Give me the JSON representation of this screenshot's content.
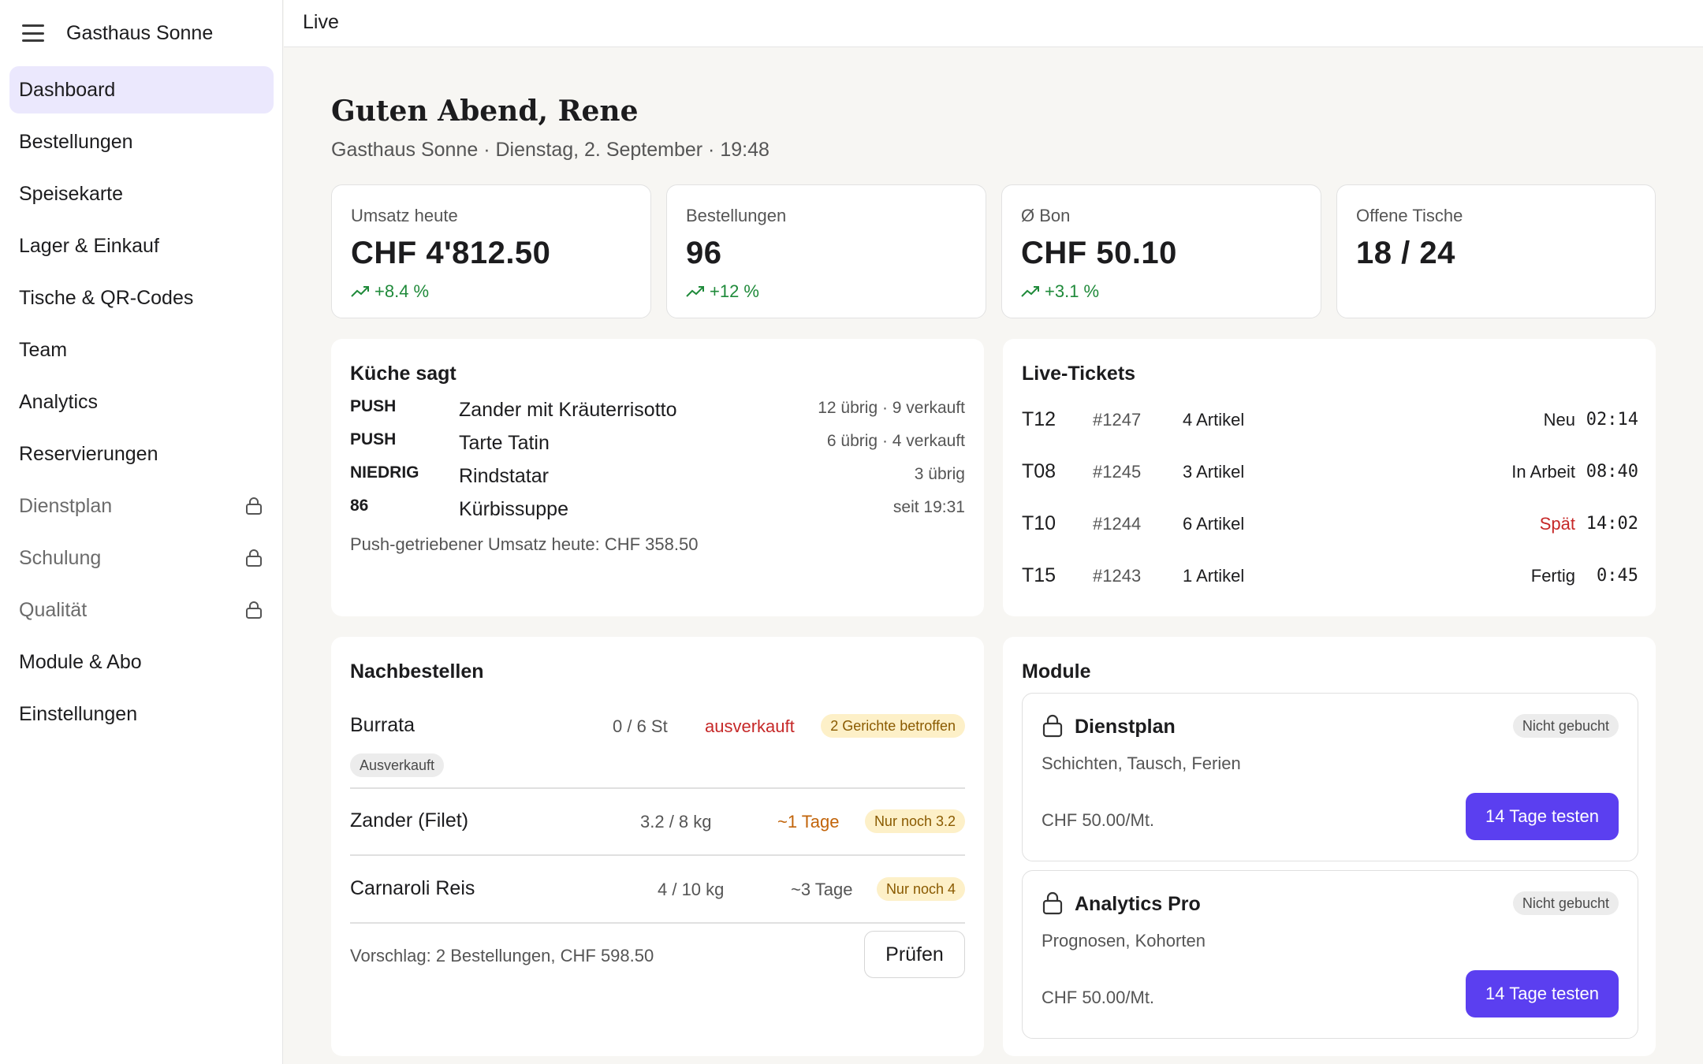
{
  "app": {
    "brand": "Gasthaus Sonne",
    "menu_icon": "hamburger-menu-icon",
    "page_title": "Live"
  },
  "sidebar": {
    "items": [
      {
        "label": "Dashboard",
        "active": true,
        "locked": false
      },
      {
        "label": "Bestellungen",
        "active": false,
        "locked": false
      },
      {
        "label": "Speisekarte",
        "active": false,
        "locked": false
      },
      {
        "label": "Lager & Einkauf",
        "active": false,
        "locked": false
      },
      {
        "label": "Tische & QR-Codes",
        "active": false,
        "locked": false
      },
      {
        "label": "Team",
        "active": false,
        "locked": false
      },
      {
        "label": "Analytics",
        "active": false,
        "locked": false
      },
      {
        "label": "Reservierungen",
        "active": false,
        "locked": false
      },
      {
        "label": "Dienstplan",
        "active": false,
        "locked": true
      },
      {
        "label": "Schulung",
        "active": false,
        "locked": true
      },
      {
        "label": "Qualität",
        "active": false,
        "locked": true
      },
      {
        "label": "Module & Abo",
        "active": false,
        "locked": false
      },
      {
        "label": "Einstellungen",
        "active": false,
        "locked": false
      }
    ]
  },
  "header": {
    "greeting": "Guten Abend, Rene",
    "subtitle": "Gasthaus Sonne · Dienstag, 2. September · 19:48"
  },
  "kpis": [
    {
      "label": "Umsatz heute",
      "value": "CHF 4'812.50",
      "delta": "+8.4 %"
    },
    {
      "label": "Bestellungen",
      "value": "96",
      "delta": "+12 %"
    },
    {
      "label": "Ø Bon",
      "value": "CHF 50.10",
      "delta": "+3.1 %"
    },
    {
      "label": "Offene Tische",
      "value": "18 / 24",
      "delta": ""
    }
  ],
  "kitchen": {
    "title": "Küche sagt",
    "rows": [
      {
        "tag": "PUSH",
        "dish": "Zander mit Kräuterrisotto",
        "info": "12 übrig · 9 verkauft"
      },
      {
        "tag": "PUSH",
        "dish": "Tarte Tatin",
        "info": "6 übrig · 4 verkauft"
      },
      {
        "tag": "NIEDRIG",
        "dish": "Rindstatar",
        "info": "3 übrig"
      },
      {
        "tag": "86",
        "dish": "Kürbissuppe",
        "info": "seit 19:31"
      }
    ],
    "footer": "Push-getriebener Umsatz heute: CHF 358.50"
  },
  "tickets": {
    "title": "Live-Tickets",
    "rows": [
      {
        "table": "T12",
        "number": "#1247",
        "items": "4 Artikel",
        "status": "Neu",
        "time": "02:14",
        "late": false
      },
      {
        "table": "T08",
        "number": "#1245",
        "items": "3 Artikel",
        "status": "In Arbeit",
        "time": "08:40",
        "late": false
      },
      {
        "table": "T10",
        "number": "#1244",
        "items": "6 Artikel",
        "status": "Spät",
        "time": "14:02",
        "late": true
      },
      {
        "table": "T15",
        "number": "#1243",
        "items": "1 Artikel",
        "status": "Fertig",
        "time": "0:45",
        "late": false
      }
    ]
  },
  "reorder": {
    "title": "Nachbestellen",
    "rows": [
      {
        "name": "Burrata",
        "qty": "0 / 6 St",
        "state": "ausverkauft",
        "badge": "2 Gerichte betroffen",
        "sub_badge": "Ausverkauft"
      },
      {
        "name": "Zander (Filet)",
        "qty": "3.2 / 8 kg",
        "state": "~1 Tage",
        "badge": "Nur noch 3.2"
      },
      {
        "name": "Carnaroli Reis",
        "qty": "4 / 10 kg",
        "state": "~3 Tage",
        "badge": "Nur noch 4"
      }
    ],
    "footer": "Vorschlag: 2 Bestellungen, CHF 598.50",
    "check_label": "Prüfen"
  },
  "modules": {
    "title": "Module",
    "items": [
      {
        "name": "Dienstplan",
        "desc": "Schichten, Tausch, Ferien",
        "badge": "Nicht gebucht",
        "price": "CHF 50.00/Mt.",
        "cta": "14 Tage testen"
      },
      {
        "name": "Analytics Pro",
        "desc": "Prognosen, Kohorten",
        "badge": "Nicht gebucht",
        "price": "CHF 50.00/Mt.",
        "cta": "14 Tage testen"
      }
    ]
  },
  "colors": {
    "accent": "#5b3ff0",
    "active_nav": "#ebe8fd",
    "positive": "#1f8a3a",
    "danger": "#c62828",
    "warning": "#c2640a"
  }
}
